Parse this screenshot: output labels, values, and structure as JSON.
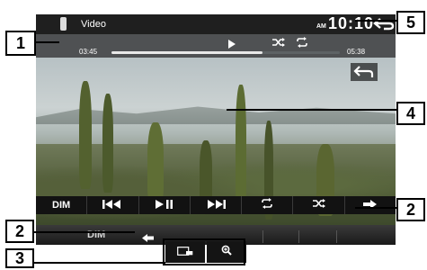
{
  "topbar": {
    "source_label": "Video",
    "ampm": "AM",
    "clock": "10:10",
    "back_icon": "back-arrow-icon"
  },
  "infobar": {
    "play_state_icon": "play-icon",
    "shuffle_state_icon": "shuffle-icon",
    "repeat_state_icon": "repeat-icon",
    "time_elapsed": "03:45",
    "time_total": "05:38",
    "progress_fraction": 0.66
  },
  "controlbar": {
    "dim_label": "DIM",
    "buttons": [
      {
        "name": "dim-button",
        "icon": "text"
      },
      {
        "name": "previous-track-button",
        "icon": "skip-previous-icon"
      },
      {
        "name": "play-pause-button",
        "icon": "play-pause-icon"
      },
      {
        "name": "next-track-button",
        "icon": "skip-next-icon"
      },
      {
        "name": "repeat-button",
        "icon": "repeat-icon"
      },
      {
        "name": "shuffle-button",
        "icon": "shuffle-icon"
      },
      {
        "name": "next-page-button",
        "icon": "arrow-right-icon"
      }
    ]
  },
  "lowerbar": {
    "dim_label": "DIM",
    "back_icon": "arrow-left-icon",
    "aspect_icon": "screen-aspect-icon",
    "zoom_icon": "zoom-icon"
  },
  "callouts": {
    "c1": "1",
    "c2a": "2",
    "c2b": "2",
    "c3": "3",
    "c4": "4",
    "c5": "5"
  },
  "colors": {
    "bar_background": "#121212",
    "callout_border": "#000000",
    "text_light": "#ffffff"
  }
}
